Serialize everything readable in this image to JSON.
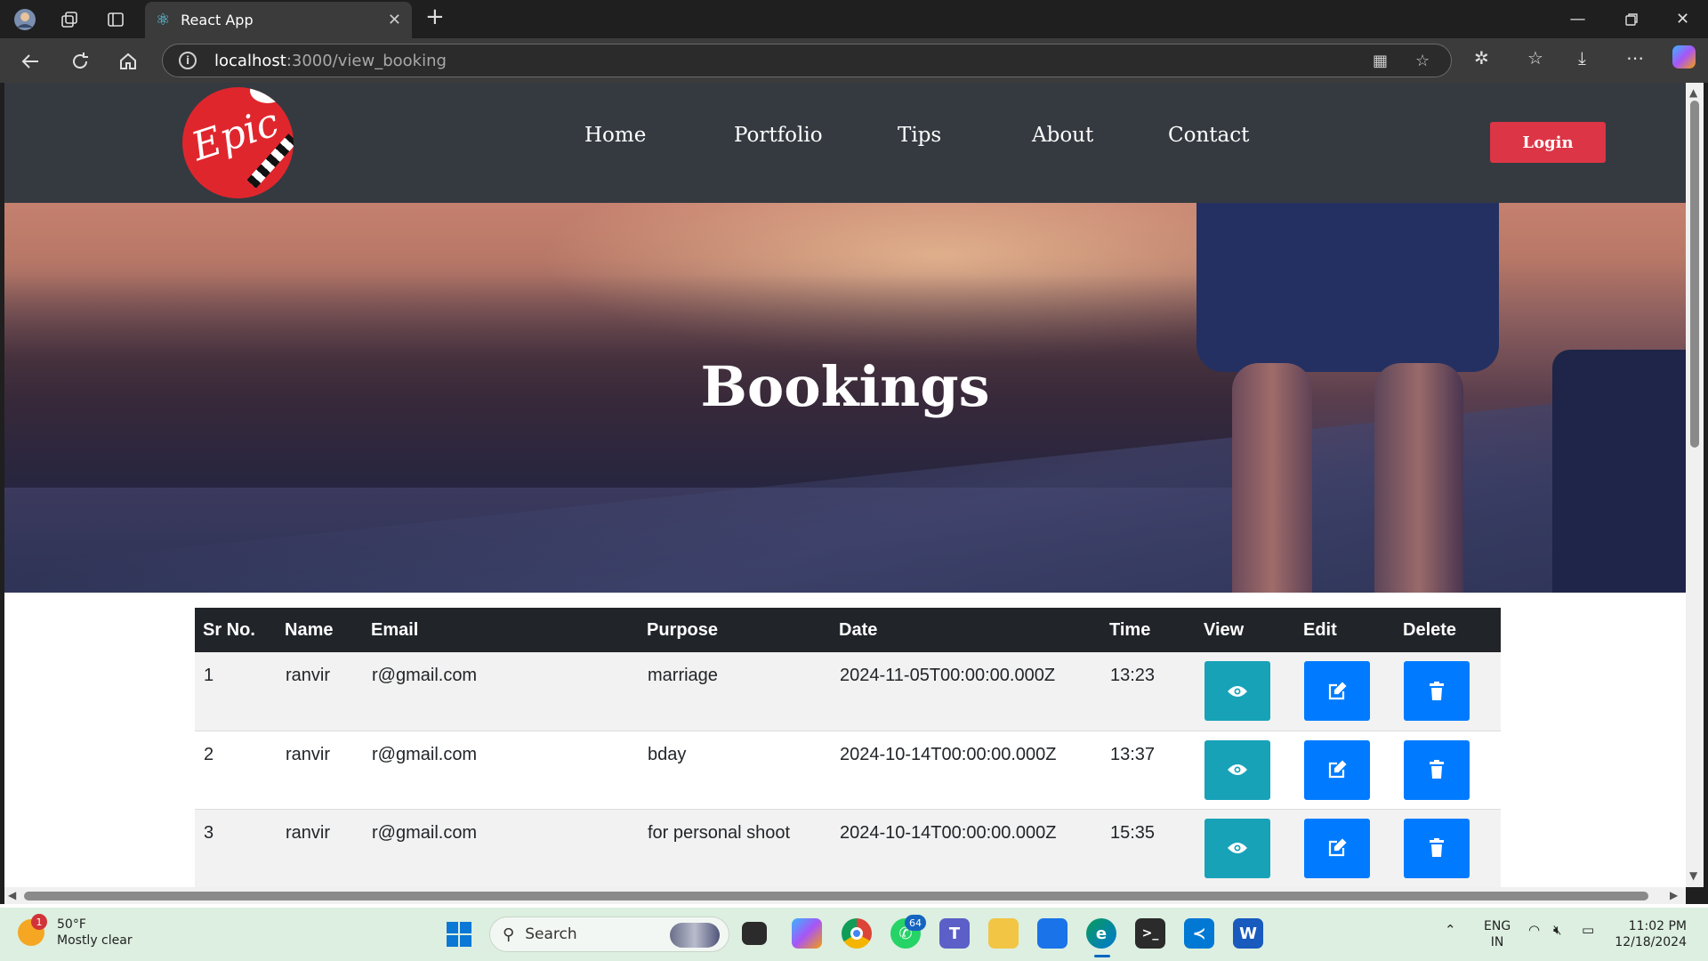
{
  "browser": {
    "tab_title": "React App",
    "url_host": "localhost",
    "url_path": ":3000/view_booking"
  },
  "site": {
    "nav": [
      {
        "label": "Home"
      },
      {
        "label": "Portfolio"
      },
      {
        "label": "Tips"
      },
      {
        "label": "About"
      },
      {
        "label": "Contact"
      }
    ],
    "login_label": "Login",
    "hero_title": "Bookings"
  },
  "table": {
    "headers": [
      "Sr No.",
      "Name",
      "Email",
      "Purpose",
      "Date",
      "Time",
      "View",
      "Edit",
      "Delete"
    ],
    "rows": [
      {
        "sr": "1",
        "name": "ranvir",
        "email": "r@gmail.com",
        "purpose": "marriage",
        "date": "2024-11-05T00:00:00.000Z",
        "time": "13:23"
      },
      {
        "sr": "2",
        "name": "ranvir",
        "email": "r@gmail.com",
        "purpose": "bday",
        "date": "2024-10-14T00:00:00.000Z",
        "time": "13:37"
      },
      {
        "sr": "3",
        "name": "ranvir",
        "email": "r@gmail.com",
        "purpose": "for personal shoot",
        "date": "2024-10-14T00:00:00.000Z",
        "time": "15:35"
      }
    ]
  },
  "taskbar": {
    "weather_temp": "50°F",
    "weather_desc": "Mostly clear",
    "weather_badge": "1",
    "search_label": "Search",
    "whatsapp_badge": "64",
    "lang_line1": "ENG",
    "lang_line2": "IN",
    "time": "11:02 PM",
    "date": "12/18/2024"
  },
  "colors": {
    "nav_bg": "#343a40",
    "login_bg": "#dc3545",
    "view_btn": "#17a2b8",
    "edit_btn": "#007bff",
    "delete_btn": "#007bff",
    "table_head": "#212529"
  }
}
